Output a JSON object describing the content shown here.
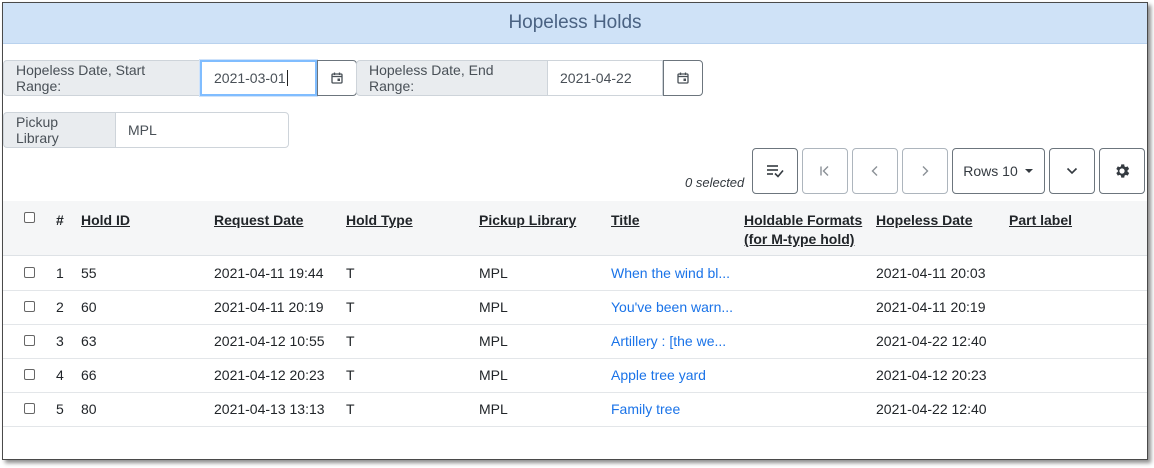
{
  "header": {
    "title": "Hopeless Holds"
  },
  "filters": {
    "start_label": "Hopeless Date, Start Range:",
    "start_value": "2021-03-01",
    "end_label": "Hopeless Date, End Range:",
    "end_value": "2021-04-22",
    "pickup_label": "Pickup Library",
    "pickup_value": "MPL"
  },
  "toolbar": {
    "selected_text": "0 selected",
    "rows_label": "Rows 10"
  },
  "columns": {
    "num": "#",
    "hold_id": "Hold ID",
    "request_date": "Request Date",
    "hold_type": "Hold Type",
    "pickup_library": "Pickup Library",
    "title": "Title",
    "holdable_formats_1": "Holdable Formats",
    "holdable_formats_2": "(for M-type hold)",
    "hopeless_date": "Hopeless Date",
    "part_label": "Part label"
  },
  "rows": [
    {
      "num": "1",
      "hold_id": "55",
      "request_date": "2021-04-11 19:44",
      "hold_type": "T",
      "pickup_library": "MPL",
      "title": "When the wind bl...",
      "hopeless_date": "2021-04-11 20:03"
    },
    {
      "num": "2",
      "hold_id": "60",
      "request_date": "2021-04-11 20:19",
      "hold_type": "T",
      "pickup_library": "MPL",
      "title": "You've been warn...",
      "hopeless_date": "2021-04-11 20:19"
    },
    {
      "num": "3",
      "hold_id": "63",
      "request_date": "2021-04-12 10:55",
      "hold_type": "T",
      "pickup_library": "MPL",
      "title": "Artillery : [the we...",
      "hopeless_date": "2021-04-22 12:40"
    },
    {
      "num": "4",
      "hold_id": "66",
      "request_date": "2021-04-12 20:23",
      "hold_type": "T",
      "pickup_library": "MPL",
      "title": "Apple tree yard",
      "hopeless_date": "2021-04-12 20:23"
    },
    {
      "num": "5",
      "hold_id": "80",
      "request_date": "2021-04-13 13:13",
      "hold_type": "T",
      "pickup_library": "MPL",
      "title": "Family tree",
      "hopeless_date": "2021-04-22 12:40"
    }
  ]
}
